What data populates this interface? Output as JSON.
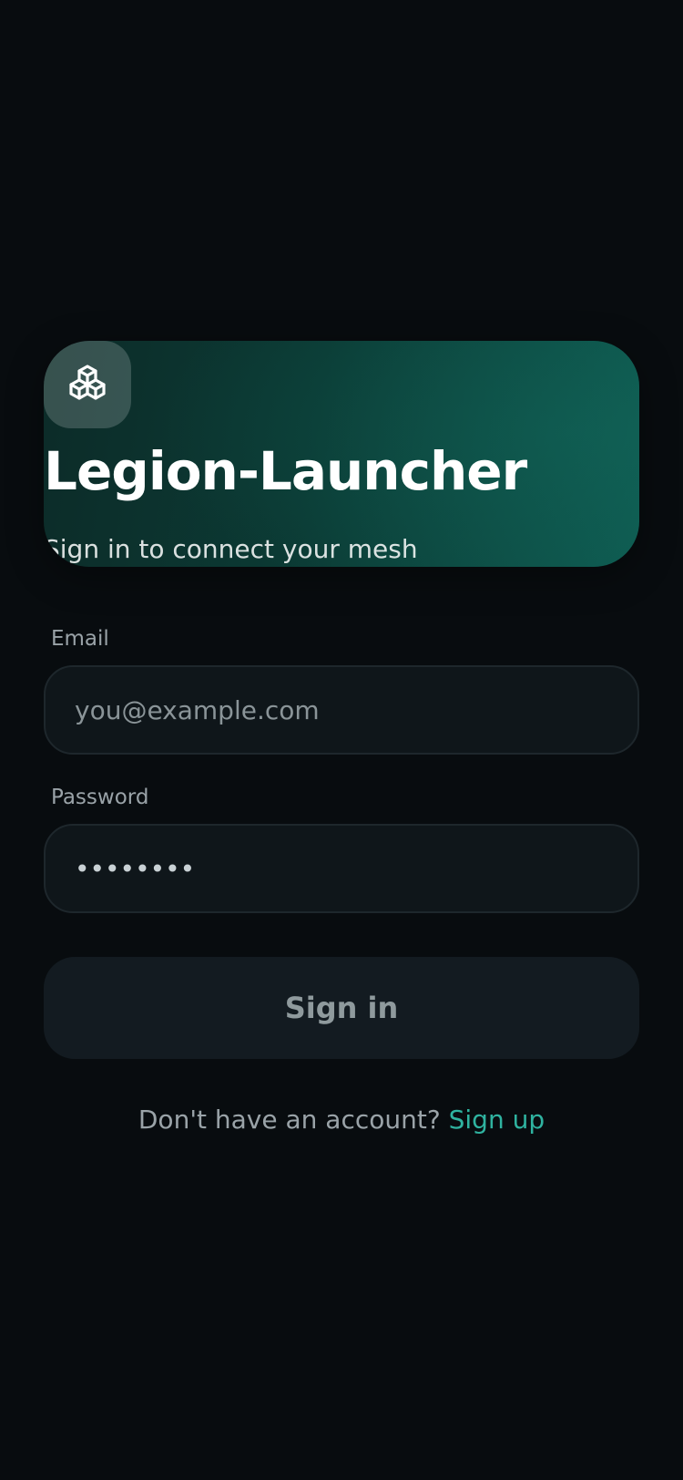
{
  "app": {
    "title": "Legion-Launcher",
    "subtitle": "Sign in to connect your mesh",
    "logo_icon": "cubes-icon"
  },
  "form": {
    "email": {
      "label": "Email",
      "placeholder": "you@example.com",
      "value": ""
    },
    "password": {
      "label": "Password",
      "value": "••••••••",
      "masked": true
    },
    "submit_label": "Sign in"
  },
  "footer": {
    "prompt": "Don't have an account?",
    "link_label": "Sign up"
  },
  "colors": {
    "background": "#080c0f",
    "accent": "#2fb3a0",
    "hero_start": "#0c2b28",
    "hero_end": "#0e5b51"
  }
}
